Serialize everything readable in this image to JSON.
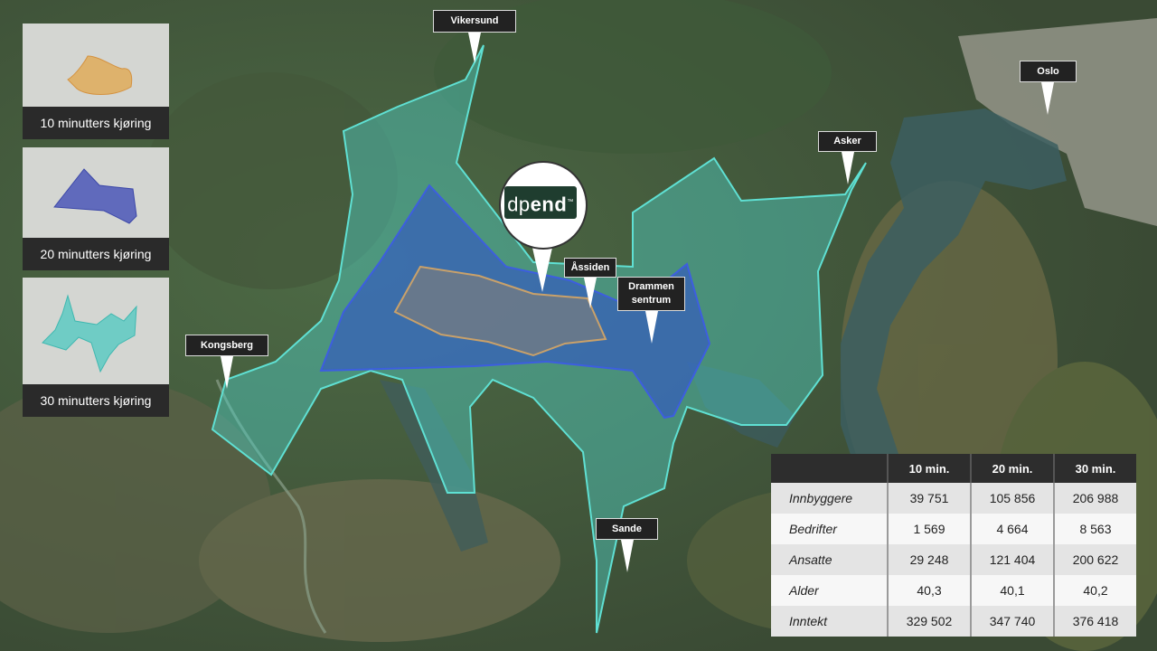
{
  "legend": [
    {
      "label": "10 minutters kjøring",
      "color": "#e1a54a"
    },
    {
      "label": "20 minutters kjøring",
      "color": "#4b57b8"
    },
    {
      "label": "30 minutters kjøring",
      "color": "#55c9c2"
    }
  ],
  "places": {
    "vikersund": "Vikersund",
    "oslo": "Oslo",
    "asker": "Asker",
    "aassiden": "Åssiden",
    "drammen_line1": "Drammen",
    "drammen_line2": "sentrum",
    "kongsberg": "Kongsberg",
    "sande": "Sande"
  },
  "logo": {
    "light": "dp",
    "bold": "end",
    "mark": "™"
  },
  "table": {
    "headers": [
      "",
      "10 min.",
      "20 min.",
      "30 min."
    ],
    "rows": [
      {
        "label": "Innbyggere",
        "values": [
          "39 751",
          "105 856",
          "206 988"
        ]
      },
      {
        "label": "Bedrifter",
        "values": [
          "1 569",
          "4 664",
          "8 563"
        ]
      },
      {
        "label": "Ansatte",
        "values": [
          "29 248",
          "121 404",
          "200 622"
        ]
      },
      {
        "label": "Alder",
        "values": [
          "40,3",
          "40,1",
          "40,2"
        ]
      },
      {
        "label": "Inntekt",
        "values": [
          "329 502",
          "347 740",
          "376 418"
        ]
      }
    ]
  },
  "colors": {
    "zone_30": "#4fd1c5",
    "zone_20": "#2f4fd0",
    "zone_10": "#b88d56",
    "label_bg": "#222222"
  }
}
